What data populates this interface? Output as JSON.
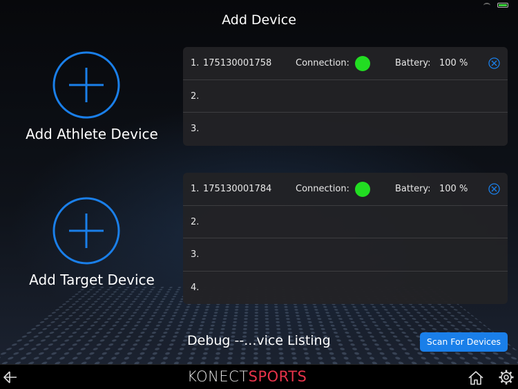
{
  "header": {
    "title": "Add Device"
  },
  "colors": {
    "accent": "#1a7fe9",
    "connected": "#22dd22",
    "brand_red": "#e6334a"
  },
  "athlete": {
    "add_label": "Add Athlete Device",
    "icon": "plus-circle-icon",
    "slots": [
      {
        "num": "1.",
        "id": "175130001758",
        "connection_label": "Connection:",
        "battery_label": "Battery:",
        "battery_value": "100 %",
        "connected": true
      },
      {
        "num": "2."
      },
      {
        "num": "3."
      }
    ]
  },
  "target": {
    "add_label": "Add Target Device",
    "icon": "plus-circle-icon",
    "slots": [
      {
        "num": "1.",
        "id": "175130001784",
        "connection_label": "Connection:",
        "battery_label": "Battery:",
        "battery_value": "100 %",
        "connected": true
      },
      {
        "num": "2."
      },
      {
        "num": "3."
      },
      {
        "num": "4."
      }
    ]
  },
  "footer": {
    "debug_text": "Debug --...vice Listing",
    "scan_label": "Scan For Devices"
  },
  "bottom_bar": {
    "logo_part1": "KONECT",
    "logo_part2": "SPORTS",
    "icons": [
      "back-arrow-icon",
      "home-icon",
      "gear-icon"
    ]
  }
}
